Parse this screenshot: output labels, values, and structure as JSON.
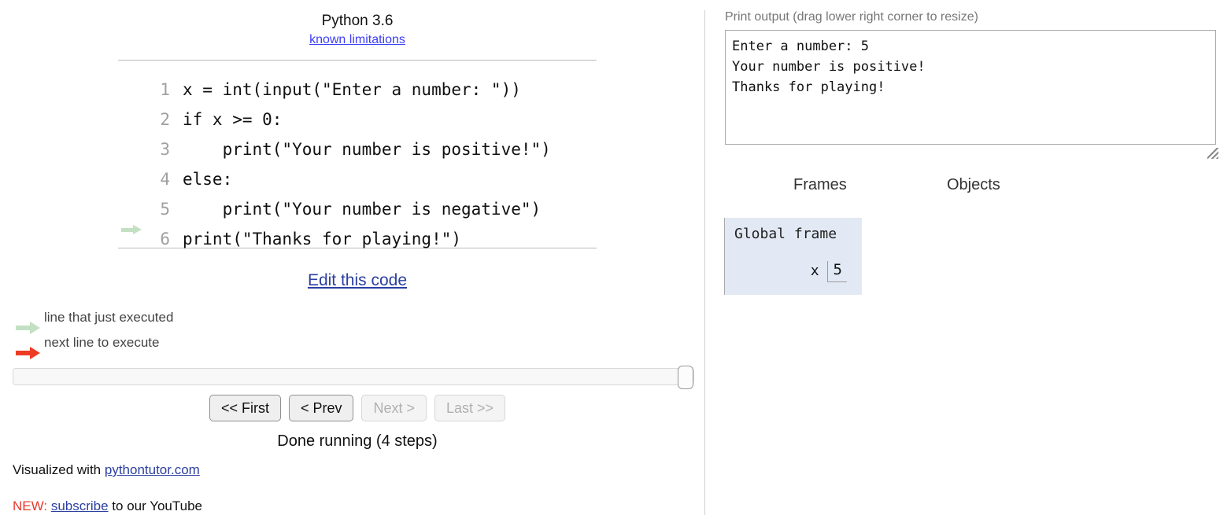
{
  "left": {
    "python_version": "Python 3.6",
    "known_limitations_link": "known limitations",
    "code_lines": [
      {
        "number": "1",
        "text": "x = int(input(\"Enter a number: \"))",
        "arrow": "none"
      },
      {
        "number": "2",
        "text": "if x >= 0:",
        "arrow": "none"
      },
      {
        "number": "3",
        "text": "    print(\"Your number is positive!\")",
        "arrow": "none"
      },
      {
        "number": "4",
        "text": "else:",
        "arrow": "none"
      },
      {
        "number": "5",
        "text": "    print(\"Your number is negative\")",
        "arrow": "none"
      },
      {
        "number": "6",
        "text": "print(\"Thanks for playing!\")",
        "arrow": "green"
      }
    ],
    "edit_code_link": "Edit this code",
    "legend": {
      "executed_label": "line that just executed",
      "next_label": "next line to execute",
      "executed_color": "#c3e0c3",
      "next_color": "#ee3b24"
    },
    "nav": {
      "first_label": "<< First",
      "prev_label": "< Prev",
      "next_label": "Next >",
      "last_label": "Last >>"
    },
    "status": "Done running (4 steps)",
    "visualized_prefix": "Visualized with ",
    "visualized_link": "pythontutor.com",
    "promo_new": "NEW:",
    "promo_link": "subscribe",
    "promo_tail": " to our YouTube"
  },
  "right": {
    "print_output_label": "Print output (drag lower right corner to resize)",
    "print_output_text": "Enter a number: 5\nYour number is positive!\nThanks for playing!",
    "frames_heading": "Frames",
    "objects_heading": "Objects",
    "global_frame_title": "Global frame",
    "variables": [
      {
        "name": "x",
        "value": "5"
      }
    ],
    "frame_bg_color": "#e2e9f4"
  }
}
